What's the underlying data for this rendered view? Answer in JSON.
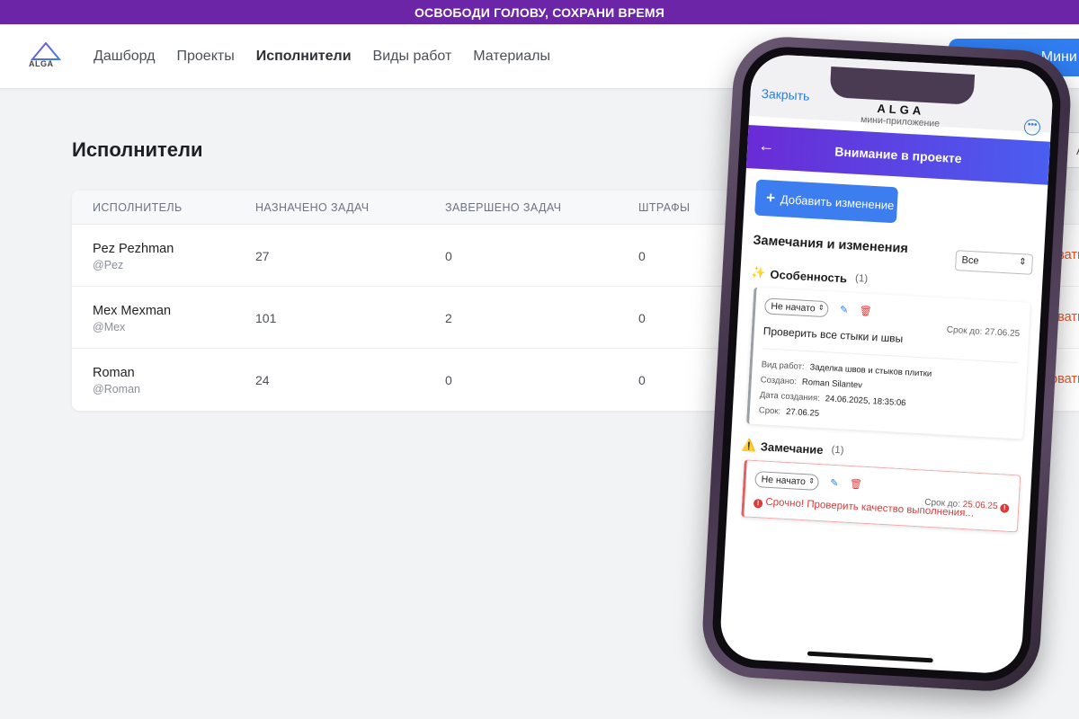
{
  "banner": {
    "text": "ОСВОБОДИ ГОЛОВУ, СОХРАНИ ВРЕМЯ"
  },
  "header": {
    "logo_text": "ALGA",
    "nav": [
      {
        "label": "Дашборд",
        "active": false
      },
      {
        "label": "Проекты",
        "active": false
      },
      {
        "label": "Исполнители",
        "active": true
      },
      {
        "label": "Виды работ",
        "active": false
      },
      {
        "label": "Материалы",
        "active": false
      }
    ],
    "button_label": "ь Мини"
  },
  "page": {
    "title": "Исполнители",
    "right_stub": "А"
  },
  "table": {
    "columns": [
      "ИСПОЛНИТЕЛЬ",
      "НАЗНАЧЕНО ЗАДАЧ",
      "ЗАВЕРШЕНО ЗАДАЧ",
      "ШТРАФЫ"
    ],
    "rows": [
      {
        "name": "Pez Pezhman",
        "username": "@Pez",
        "assigned": "27",
        "completed": "0",
        "fines": "0",
        "action": "ровать"
      },
      {
        "name": "Mex Mexman",
        "username": "@Mex",
        "assigned": "101",
        "completed": "2",
        "fines": "0",
        "action": "ровать"
      },
      {
        "name": "Roman",
        "username": "@Roman",
        "assigned": "24",
        "completed": "0",
        "fines": "0",
        "action": "ровать"
      }
    ]
  },
  "phone": {
    "tg": {
      "close": "Закрыть",
      "title": "ALGA",
      "subtitle": "мини-приложение"
    },
    "app_bar_title": "Внимание в проекте",
    "add_button": "Добавить изменение",
    "section_title": "Замечания и изменения",
    "filter_value": "Все",
    "groups": [
      {
        "emoji": "✨",
        "title": "Особенность",
        "count": "(1)",
        "card": {
          "status": "Не начато",
          "due_label": "Срок до: 27.06.25",
          "text": "Проверить все стыки и швы",
          "meta": [
            {
              "k": "Вид работ:",
              "v": "Заделка швов и стыков плитки"
            },
            {
              "k": "Создано:",
              "v": "Roman Silantev"
            },
            {
              "k": "Дата создания:",
              "v": "24.06.2025, 18:35:06"
            },
            {
              "k": "Срок:",
              "v": "27.06.25"
            }
          ]
        }
      },
      {
        "emoji": "⚠️",
        "title": "Замечание",
        "count": "(1)",
        "card": {
          "status": "Не начато",
          "due_label": "Срок до:",
          "due_value": "25.06.25",
          "text": "Срочно! Проверить качество выполнения..."
        }
      }
    ]
  },
  "colors": {
    "banner": "#6b25a6",
    "accent": "#2f7df0",
    "action": "#e0572c",
    "danger": "#d93a3a"
  }
}
